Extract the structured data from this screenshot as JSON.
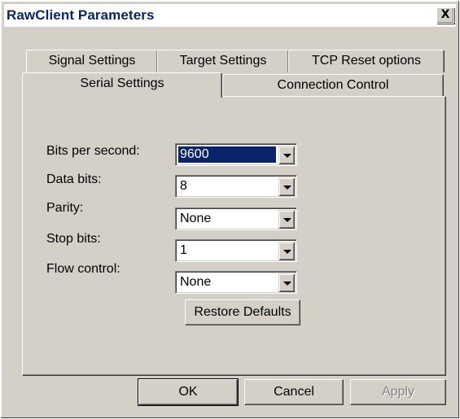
{
  "window": {
    "title": "RawClient Parameters",
    "close_label": "X"
  },
  "tabs": {
    "row1": [
      "Signal Settings",
      "Target Settings",
      "TCP Reset options"
    ],
    "row2": [
      "Serial Settings",
      "Connection Control"
    ],
    "active": "Serial Settings"
  },
  "serial": {
    "bits_per_second": {
      "label": "Bits per second:",
      "value": "9600"
    },
    "data_bits": {
      "label": "Data bits:",
      "value": "8"
    },
    "parity": {
      "label": "Parity:",
      "value": "None"
    },
    "stop_bits": {
      "label": "Stop bits:",
      "value": "1"
    },
    "flow_control": {
      "label": "Flow control:",
      "value": "None"
    },
    "restore_label": "Restore Defaults"
  },
  "footer": {
    "ok_label": "OK",
    "cancel_label": "Cancel",
    "apply_label": "Apply"
  },
  "colors": {
    "face": "#d4d0c8",
    "selection": "#0a246a",
    "title_text": "#0a246a"
  },
  "icons": {
    "combo_arrow": "chevron-down-icon"
  }
}
